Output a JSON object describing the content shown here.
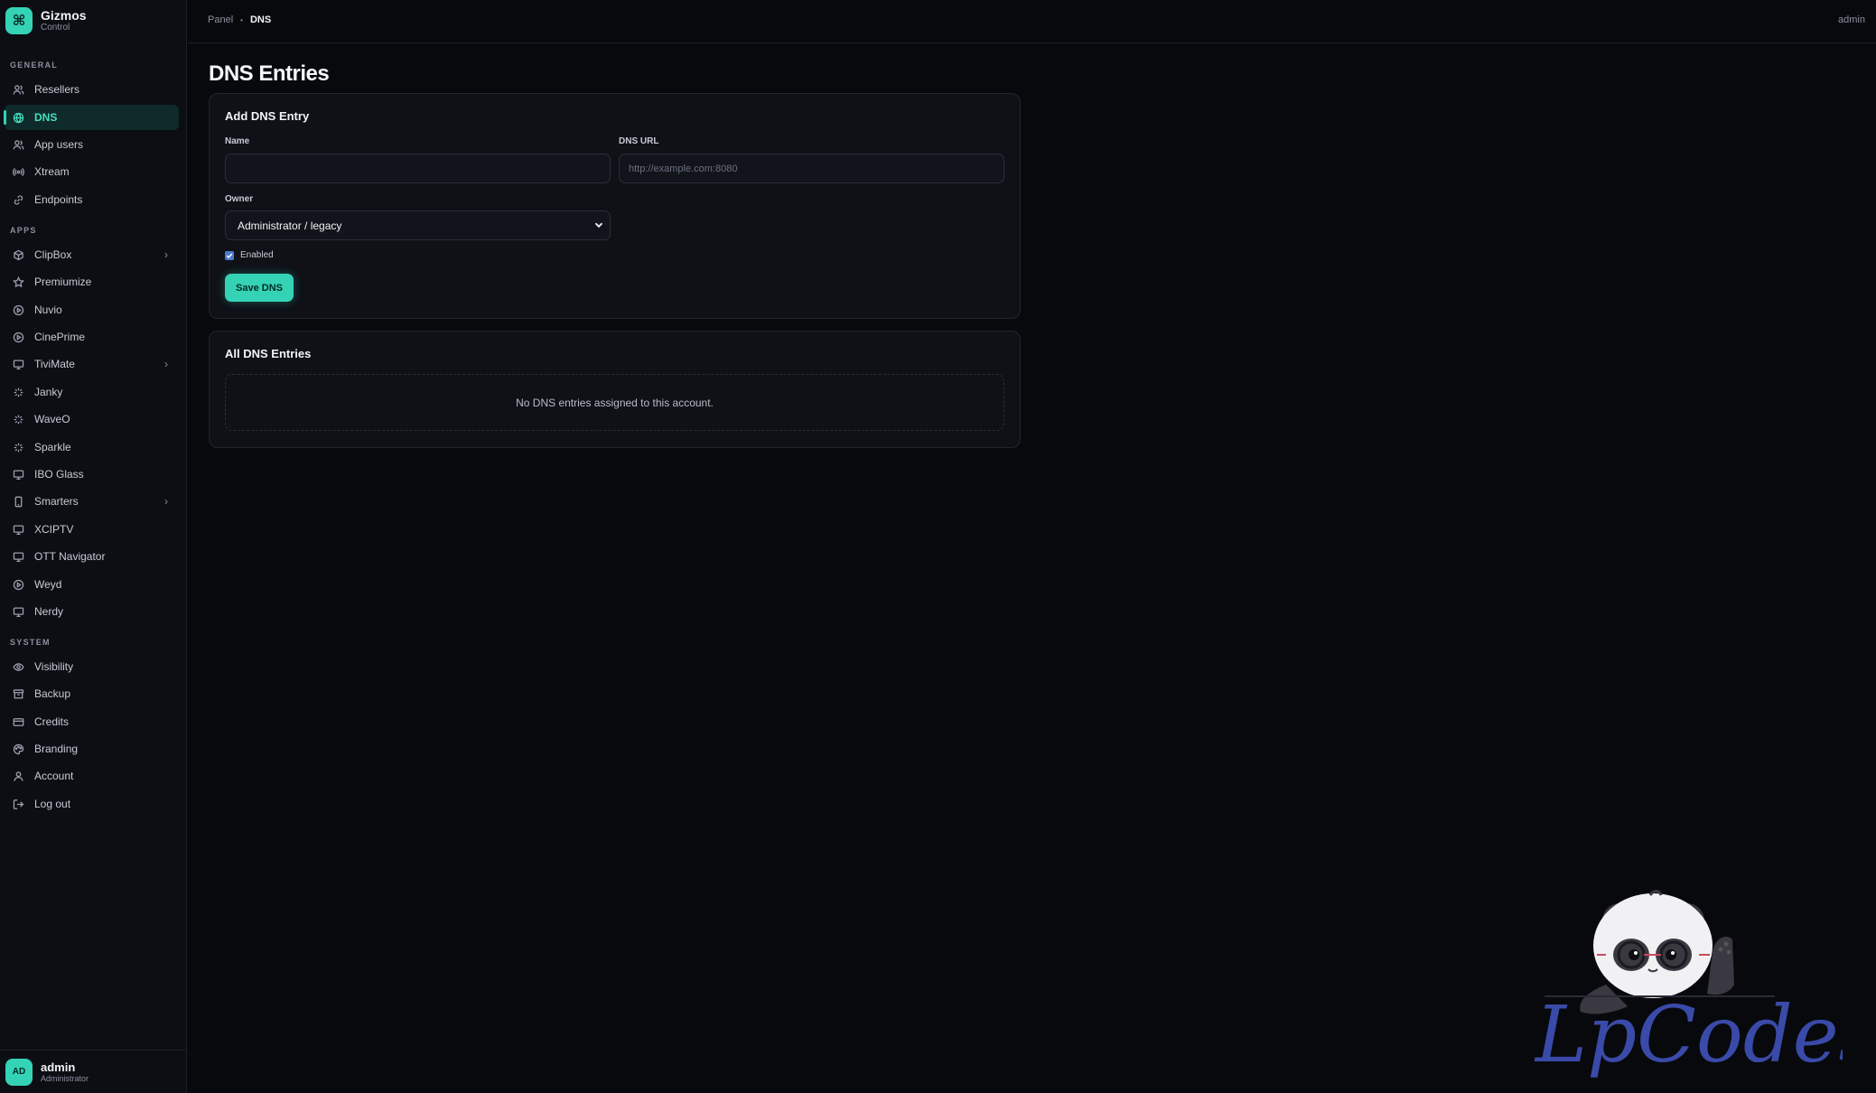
{
  "brand": {
    "name": "Gizmos",
    "subtitle": "Control",
    "logo_glyph": "⌘"
  },
  "sidebar": {
    "sections": {
      "general": "GENERAL",
      "apps": "APPS",
      "system": "SYSTEM"
    },
    "general_items": [
      {
        "label": "Resellers",
        "icon": "users-icon"
      },
      {
        "label": "DNS",
        "icon": "globe-icon",
        "active": true
      },
      {
        "label": "App users",
        "icon": "users-icon"
      },
      {
        "label": "Xtream",
        "icon": "broadcast-icon"
      },
      {
        "label": "Endpoints",
        "icon": "link-icon"
      }
    ],
    "app_items": [
      {
        "label": "ClipBox",
        "icon": "box-icon",
        "has_children": true
      },
      {
        "label": "Premiumize",
        "icon": "star-icon"
      },
      {
        "label": "Nuvio",
        "icon": "play-circle-icon"
      },
      {
        "label": "CinePrime",
        "icon": "play-circle-icon"
      },
      {
        "label": "TiviMate",
        "icon": "monitor-icon",
        "has_children": true
      },
      {
        "label": "Janky",
        "icon": "sparkle-icon"
      },
      {
        "label": "WaveO",
        "icon": "sparkle-icon"
      },
      {
        "label": "Sparkle",
        "icon": "sparkle-icon"
      },
      {
        "label": "IBO Glass",
        "icon": "monitor-icon"
      },
      {
        "label": "Smarters",
        "icon": "phone-icon",
        "has_children": true
      },
      {
        "label": "XCIPTV",
        "icon": "monitor-icon"
      },
      {
        "label": "OTT Navigator",
        "icon": "monitor-icon"
      },
      {
        "label": "Weyd",
        "icon": "play-circle-icon"
      },
      {
        "label": "Nerdy",
        "icon": "monitor-icon"
      }
    ],
    "system_items": [
      {
        "label": "Visibility",
        "icon": "eye-icon"
      },
      {
        "label": "Backup",
        "icon": "archive-icon"
      },
      {
        "label": "Credits",
        "icon": "card-icon"
      },
      {
        "label": "Branding",
        "icon": "palette-icon"
      },
      {
        "label": "Account",
        "icon": "user-icon"
      },
      {
        "label": "Log out",
        "icon": "logout-icon"
      }
    ],
    "footer": {
      "initials": "AD",
      "name": "admin",
      "role": "Administrator"
    }
  },
  "topbar": {
    "breadcrumb_root": "Panel",
    "breadcrumb_sep": "•",
    "breadcrumb_current": "DNS",
    "user": "admin"
  },
  "page": {
    "title": "DNS Entries",
    "add_card": {
      "title": "Add DNS Entry",
      "name_label": "Name",
      "name_value": "",
      "dns_url_label": "DNS URL",
      "dns_url_placeholder": "http://example.com:8080",
      "owner_label": "Owner",
      "owner_value": "Administrator / legacy",
      "enabled_label": "Enabled",
      "enabled_checked": true,
      "save_label": "Save DNS"
    },
    "list_card": {
      "title": "All DNS Entries",
      "empty_text": "No DNS entries assigned to this account."
    }
  },
  "watermark": {
    "text": "LpCodes"
  },
  "colors": {
    "accent": "#34d3b6",
    "background": "#08090d",
    "panel": "#0f1117",
    "watermark": "#3a4aa8"
  }
}
